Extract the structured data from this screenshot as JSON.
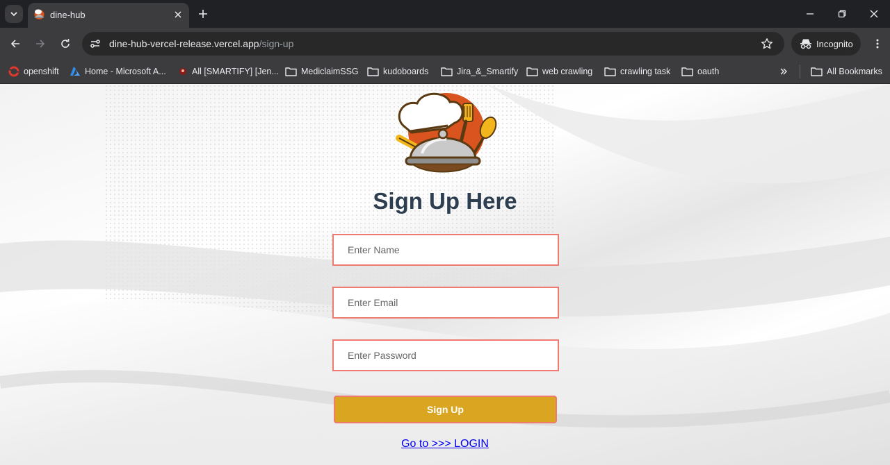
{
  "browser": {
    "tab": {
      "title": "dine-hub"
    },
    "url": {
      "host": "dine-hub-vercel-release.vercel.app",
      "path": "/sign-up"
    },
    "incognito_label": "Incognito",
    "bookmarks": [
      {
        "label": "openshift",
        "icon": "openshift-icon"
      },
      {
        "label": "Home - Microsoft A...",
        "icon": "azure-icon"
      },
      {
        "label": "All [SMARTIFY] [Jen...",
        "icon": "jenkins-icon"
      },
      {
        "label": "MediclaimSSG",
        "icon": "folder-icon"
      },
      {
        "label": "kudoboards",
        "icon": "folder-icon"
      },
      {
        "label": "Jira_&_Smartify",
        "icon": "folder-icon"
      },
      {
        "label": "web crawling",
        "icon": "folder-icon"
      },
      {
        "label": "crawling task",
        "icon": "folder-icon"
      },
      {
        "label": "oauth",
        "icon": "folder-icon"
      }
    ],
    "all_bookmarks_label": "All Bookmarks"
  },
  "page": {
    "heading": "Sign Up Here",
    "name_placeholder": "Enter Name",
    "email_placeholder": "Enter Email",
    "password_placeholder": "Enter Password",
    "signup_label": "Sign Up",
    "login_link": "Go to >>> LOGIN"
  },
  "colors": {
    "accent": "#daa520",
    "input_border": "#ee7b6f",
    "heading": "#2c3e50",
    "link": "#0000ee"
  }
}
